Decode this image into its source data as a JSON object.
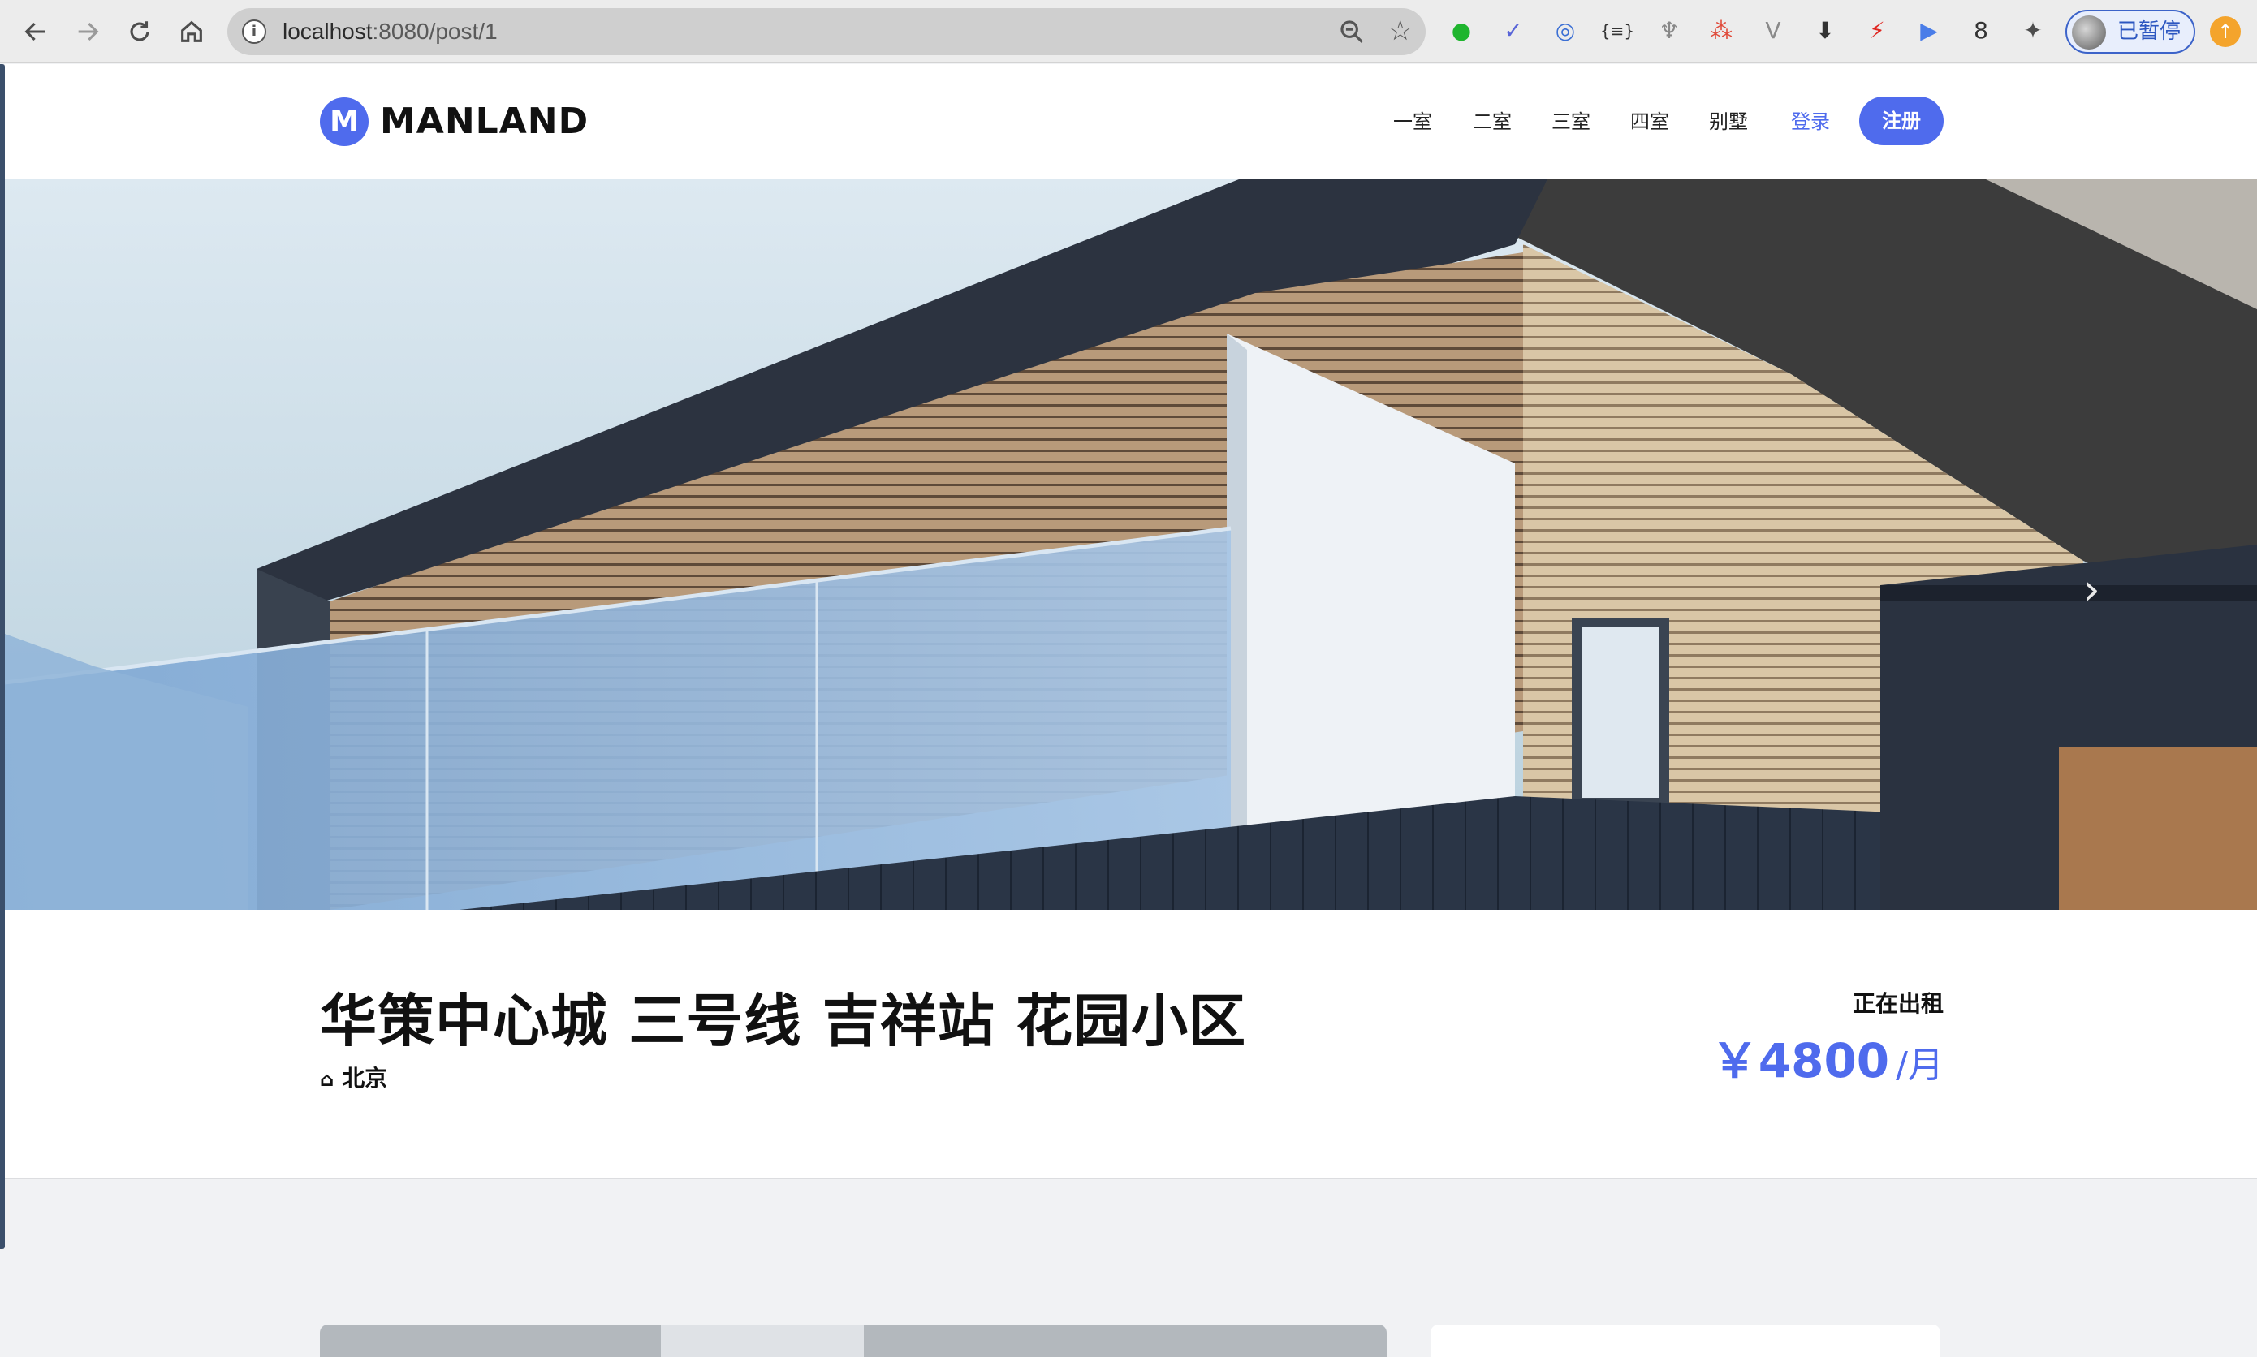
{
  "browser": {
    "url_host": "localhost",
    "url_rest": ":8080/post/1",
    "info_glyph": "i",
    "star_glyph": "☆",
    "profile_label": "已暂停",
    "update_glyph": "↑",
    "extensions": [
      "●",
      "✓",
      "◎",
      "{≡}",
      "♆",
      "⁂",
      "V",
      "⬇",
      "⚡",
      "▶",
      "8",
      "✦"
    ]
  },
  "site": {
    "logo_mark": "M",
    "logo_text": "MANLAND",
    "nav": [
      "一室",
      "二室",
      "三室",
      "四室",
      "别墅"
    ],
    "login": "登录",
    "signup": "注册"
  },
  "hero": {
    "next_arrow": "›",
    "slides_total": 2,
    "active_slide": 1
  },
  "listing": {
    "title": "华策中心城 三号线 吉祥站 花园小区",
    "location_icon": "⌂",
    "location": "北京",
    "status": "正在出租",
    "price": "￥4800",
    "price_unit": "/月"
  },
  "colors": {
    "accent": "#4f6bed"
  }
}
